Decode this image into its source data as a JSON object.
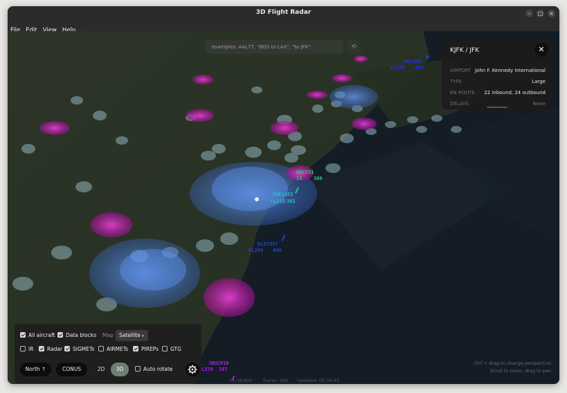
{
  "window": {
    "title": "3D Flight Radar"
  },
  "menu": [
    "File",
    "Edit",
    "View",
    "Help"
  ],
  "search": {
    "placeholder": "examples: AAL77, \"BOS to LAX\", \"to JFK\""
  },
  "airport_panel": {
    "title": "KJFK / JFK",
    "rows": [
      {
        "key": "AIRPORT",
        "value": "John F. Kennedy International"
      },
      {
        "key": "TYPE",
        "value": "Large"
      },
      {
        "key": "EN ROUTE",
        "value": "22 inbound, 24 outbound"
      },
      {
        "key": "DELAYS",
        "value": "None"
      }
    ]
  },
  "flights": [
    {
      "callsign": "AAL490",
      "alt": "FL380",
      "spd": "480",
      "color": "#2233dd"
    },
    {
      "callsign": "DAL551",
      "alt": "15",
      "spd": "360",
      "color": "#20d070"
    },
    {
      "callsign": "ENE1453",
      "alt": "FL216",
      "spd": "381",
      "color": "#26c0c0"
    },
    {
      "callsign": "DL67397",
      "alt": "FL299",
      "spd": "449",
      "color": "#2244cc"
    },
    {
      "callsign": "JBU2910",
      "alt": "L378",
      "spd": "187",
      "color": "#b020e0"
    }
  ],
  "controls": {
    "row1": [
      {
        "label": "All aircraft",
        "checked": true
      },
      {
        "label": "Data blocks",
        "checked": true
      }
    ],
    "map_label": "Map",
    "map_value": "Satellite",
    "row2": [
      {
        "label": "IR",
        "checked": false
      },
      {
        "label": "Radar",
        "checked": true
      },
      {
        "label": "SIGMETs",
        "checked": true
      },
      {
        "label": "AIRMETs",
        "checked": false
      },
      {
        "label": "PIREPs",
        "checked": true
      },
      {
        "label": "GTG",
        "checked": false
      }
    ],
    "north_button": "North ↑",
    "conus_button": "CONUS",
    "view_2d": "2D",
    "view_3d": "3D",
    "auto_rotate": "Auto rotate",
    "active_view": "3D"
  },
  "hints": {
    "line1": "Ctrl + drag to change perspective.",
    "line2": "Scroll to zoom, drag to pan."
  },
  "status": {
    "time": "05:39:892",
    "tracks": "Tracks: 189",
    "updated": "Updated: 05:39:45"
  },
  "colors": {
    "sigmet": "#c020b0",
    "radar_blue": "#4a7fe0",
    "cloud": "#8fb0b8",
    "panel_bg": "#1c1c1c",
    "toggle_active": "#6f7f74"
  }
}
